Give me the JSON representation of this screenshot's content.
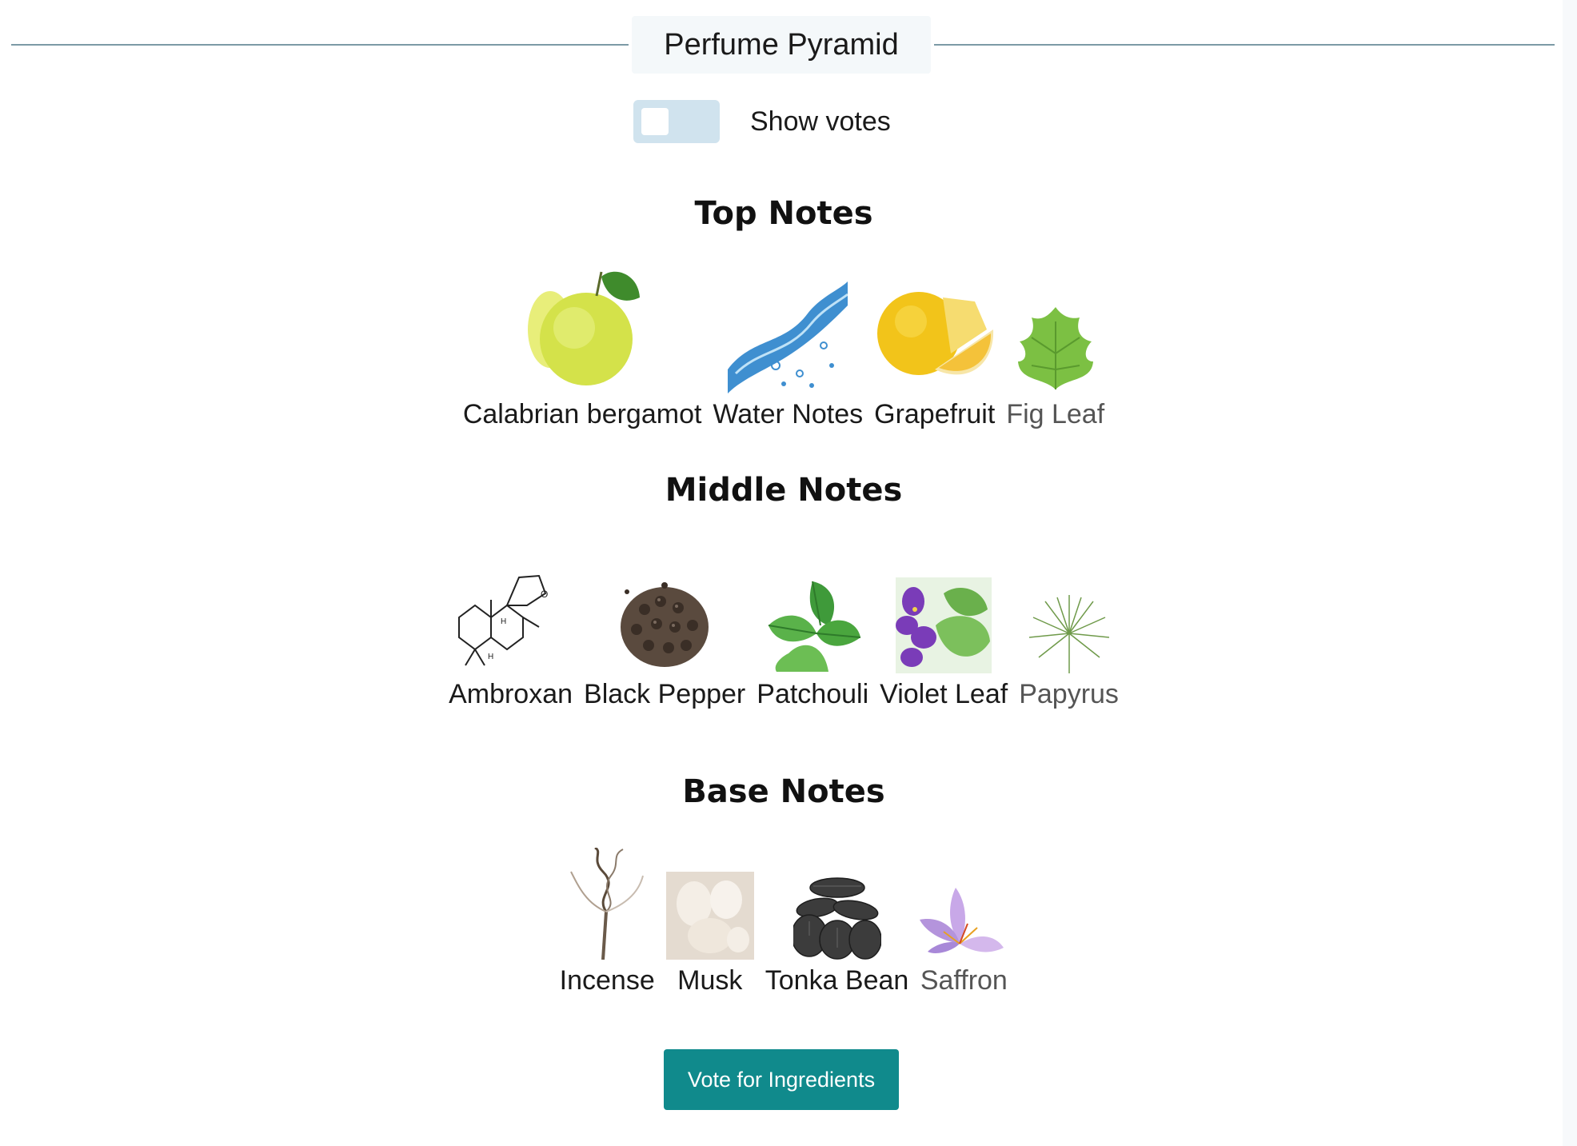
{
  "header": {
    "title": "Perfume Pyramid"
  },
  "toggle": {
    "label": "Show votes",
    "checked": false
  },
  "sections": {
    "top": {
      "title": "Top Notes",
      "notes": [
        {
          "label": "Calabrian bergamot",
          "icon": "bergamot-icon"
        },
        {
          "label": "Water Notes",
          "icon": "water-splash-icon"
        },
        {
          "label": "Grapefruit",
          "icon": "grapefruit-icon"
        },
        {
          "label": "Fig Leaf",
          "icon": "fig-leaf-icon"
        }
      ]
    },
    "middle": {
      "title": "Middle Notes",
      "notes": [
        {
          "label": "Ambroxan",
          "icon": "molecule-structure-icon"
        },
        {
          "label": "Black Pepper",
          "icon": "black-pepper-icon"
        },
        {
          "label": "Patchouli",
          "icon": "patchouli-leaf-icon"
        },
        {
          "label": "Violet Leaf",
          "icon": "violet-flower-icon"
        },
        {
          "label": "Papyrus",
          "icon": "papyrus-plant-icon"
        }
      ]
    },
    "base": {
      "title": "Base Notes",
      "notes": [
        {
          "label": "Incense",
          "icon": "incense-smoke-icon"
        },
        {
          "label": "Musk",
          "icon": "musk-icon"
        },
        {
          "label": "Tonka Bean",
          "icon": "tonka-bean-icon"
        },
        {
          "label": "Saffron",
          "icon": "saffron-flower-icon"
        }
      ]
    }
  },
  "actions": {
    "vote_label": "Vote for Ingredients"
  },
  "colors": {
    "accent": "#108a8c",
    "toggle_track": "#d0e3ee",
    "divider": "#7c9aa6"
  }
}
